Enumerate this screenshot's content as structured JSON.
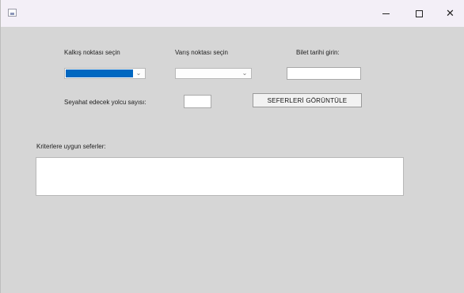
{
  "window": {
    "title": "",
    "controls": {
      "minimize": "minimize-icon",
      "maximize": "maximize-icon",
      "close": "close-icon",
      "close_glyph": "✕"
    }
  },
  "form": {
    "departure_label": "Kalkış noktası seçin",
    "arrival_label": "Varış noktası seçin",
    "date_label": "Bilet tarihi girin:",
    "date_value": "",
    "passenger_label": "Seyahat edecek yolcu sayısı:",
    "passenger_value": "",
    "show_button": "SEFERLERİ GÖRÜNTÜLE",
    "results_label": "Kriterlere uygun seferler:",
    "combo_arrow": "⌄"
  },
  "colors": {
    "selection": "#0067c0",
    "window_bg": "#d6d6d6",
    "titlebar_bg": "#f3eff7"
  }
}
